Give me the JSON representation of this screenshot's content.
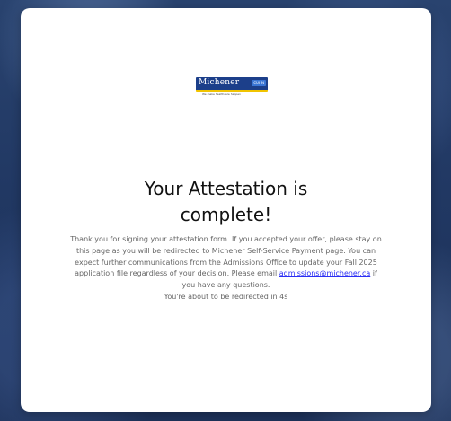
{
  "logo": {
    "name": "Michener",
    "tag": "CUHN",
    "tagline": "We make healthcare happen"
  },
  "card": {
    "title_line1": "Your Attestation is",
    "title_line2": "complete!",
    "message_part1": "Thank you for signing your attestation form. If you accepted your offer, please stay on this page as you will be redirected to Michener Self-Service Payment page. You can expect further communications from the Admissions Office to update your Fall 2025 application file regardless of your decision. Please email",
    "email": "admissions@michener.ca",
    "email_href": "mailto:admissions@michener.ca",
    "message_part2": "if you have any questions.",
    "redirect_notice": "You're about to be redirected in 4s"
  },
  "colors": {
    "background": "#1f3560",
    "card": "#ffffff",
    "logo_blue": "#1c3f8a",
    "logo_accent": "#f1c400",
    "link": "#2b2ff5"
  }
}
